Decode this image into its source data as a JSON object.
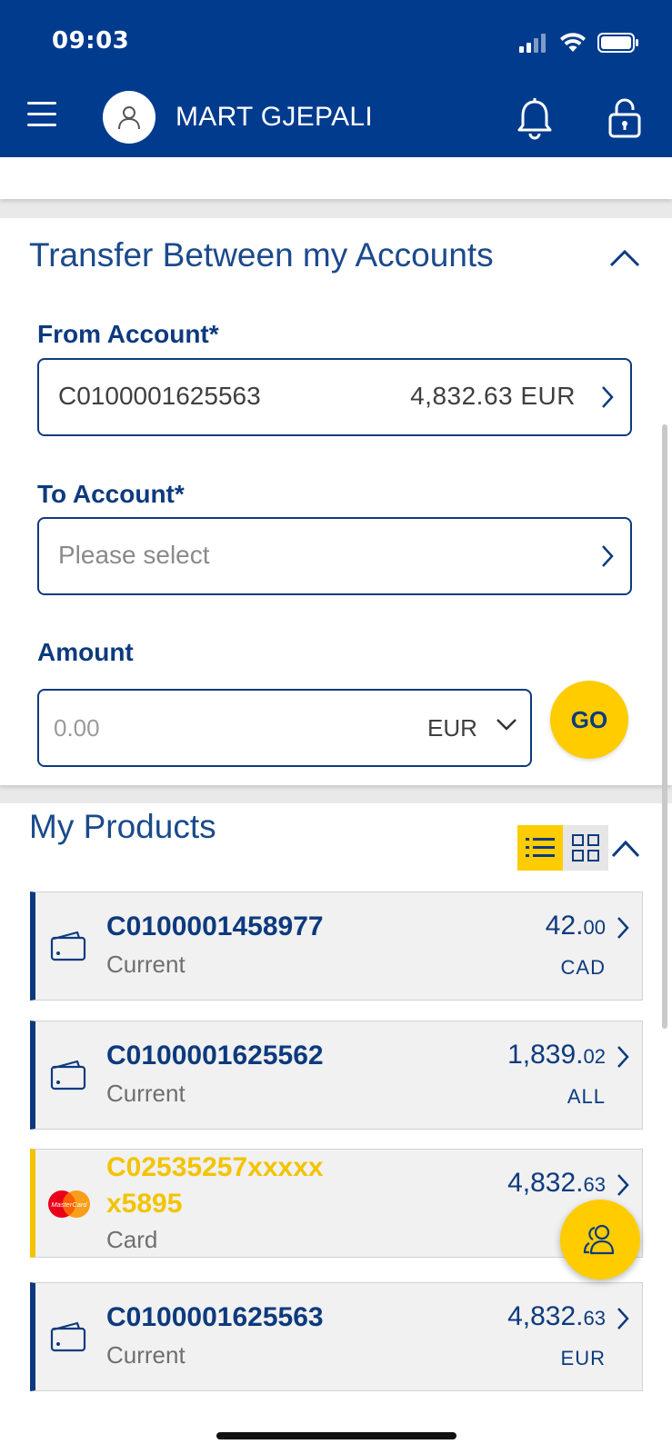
{
  "status_bar": {
    "time": "09:03"
  },
  "header": {
    "user_name": "MART GJEPALI"
  },
  "transfer": {
    "title": "Transfer Between my Accounts",
    "from_label": "From Account",
    "from_account": "C0100001625563",
    "from_balance": "4,832.63 EUR",
    "to_label": "To Account",
    "to_placeholder": "Please select",
    "amount_label": "Amount",
    "amount_placeholder": "0.00",
    "currency": "EUR",
    "go_label": "GO",
    "required_mark": "*"
  },
  "products": {
    "title": "My Products",
    "items": [
      {
        "id": "C0100001458977",
        "type": "Current",
        "amount_main": "42.",
        "amount_dec": "00",
        "currency": "CAD",
        "kind": "account"
      },
      {
        "id": "C0100001625562",
        "type": "Current",
        "amount_main": "1,839.",
        "amount_dec": "02",
        "currency": "ALL",
        "kind": "account"
      },
      {
        "id": "C02535257xxxxx x5895",
        "type": "Card",
        "amount_main": "4,832.",
        "amount_dec": "63",
        "currency": "",
        "kind": "card"
      },
      {
        "id": "C0100001625563",
        "type": "Current",
        "amount_main": "4,832.",
        "amount_dec": "63",
        "currency": "EUR",
        "kind": "account"
      }
    ]
  },
  "colors": {
    "brand_blue": "#003b8e",
    "accent_yellow": "#ffcc00",
    "text_blue": "#0d3a7e"
  },
  "icons": [
    "menu-icon",
    "user-icon",
    "bell-icon",
    "unlock-icon",
    "list-view-icon",
    "grid-view-icon",
    "wallet-icon",
    "mastercard-icon",
    "contacts-icon"
  ]
}
